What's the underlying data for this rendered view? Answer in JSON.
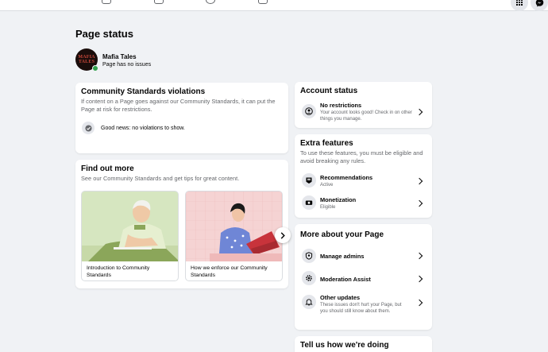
{
  "header": {
    "nav": [
      {
        "name": "pages-nav-icon"
      },
      {
        "name": "video-nav-icon"
      },
      {
        "name": "groups-nav-icon"
      },
      {
        "name": "gaming-nav-icon"
      }
    ],
    "menu_icon": "grid-menu-icon",
    "messenger_icon": "messenger-icon"
  },
  "page_status": {
    "title": "Page status",
    "page_name": "Mafia Tales",
    "page_subtitle": "Page has no issues",
    "avatar_text_line1": "MAFIA",
    "avatar_text_line2": "TALES"
  },
  "violations": {
    "title": "Community Standards violations",
    "description": "If content on a Page goes against our Community Standards, it can put the Page at risk for restrictions.",
    "status": "Good news: no violations to show."
  },
  "find_out_more": {
    "title": "Find out more",
    "description": "See our Community Standards and get tips for great content.",
    "articles": [
      {
        "caption": "Introduction to Community Standards"
      },
      {
        "caption": "How we enforce our Community Standards"
      }
    ]
  },
  "account_status": {
    "title": "Account status",
    "row_title": "No restrictions",
    "row_subtitle": "Your account looks good! Check in on other things you manage."
  },
  "extra_features": {
    "title": "Extra features",
    "description": "To use these features, you must be eligible and avoid breaking any rules.",
    "items": [
      {
        "title": "Recommendations",
        "subtitle": "Active"
      },
      {
        "title": "Monetization",
        "subtitle": "Eligible"
      }
    ]
  },
  "more_about": {
    "title": "More about your Page",
    "items": [
      {
        "title": "Manage admins"
      },
      {
        "title": "Moderation Assist"
      },
      {
        "title": "Other updates",
        "subtitle": "These issues don't hurt your Page, but you should still know about them."
      }
    ]
  },
  "feedback": {
    "title": "Tell us how we're doing"
  },
  "colors": {
    "background": "#f0f2f5",
    "card": "#ffffff",
    "status_green": "#31a24c",
    "secondary_text": "#65676b"
  }
}
